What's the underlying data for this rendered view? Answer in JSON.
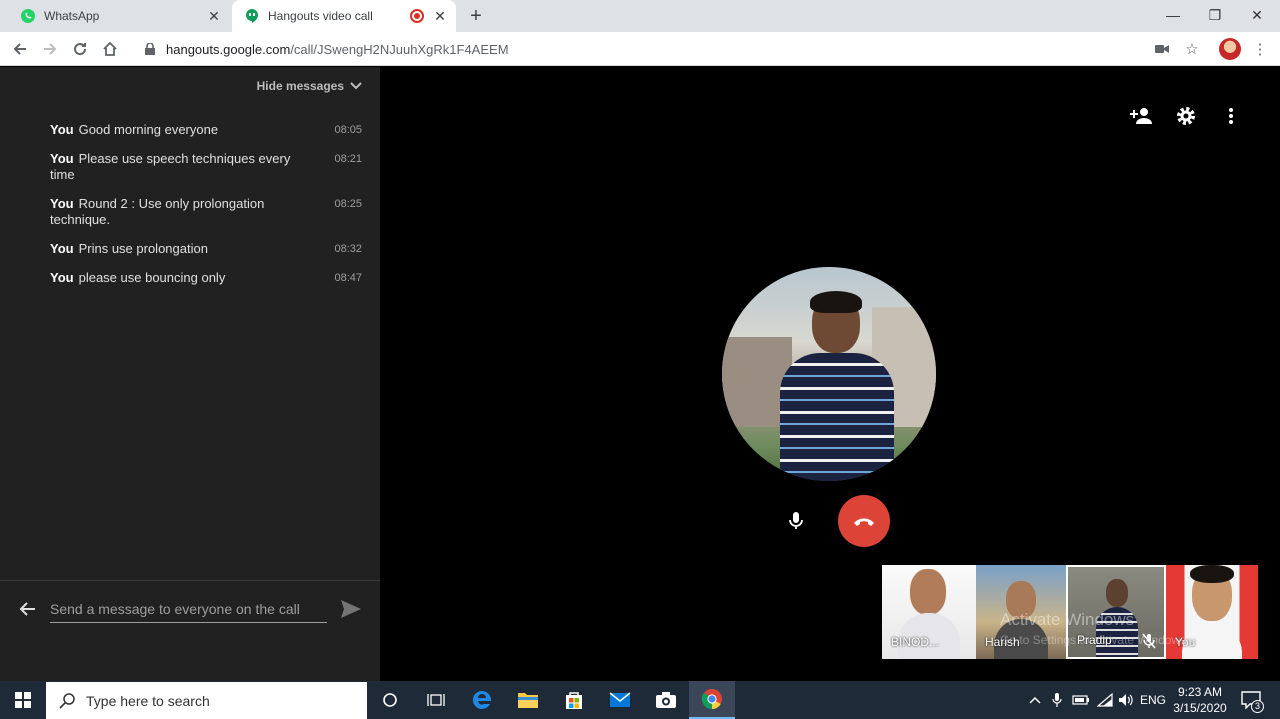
{
  "browser": {
    "tabs": [
      {
        "title": "WhatsApp",
        "active": false
      },
      {
        "title": "Hangouts video call",
        "active": true
      }
    ],
    "url_host": "hangouts.google.com",
    "url_path": "/call/JSwengH2NJuuhXgRk1F4AEEM"
  },
  "chat": {
    "hide_label": "Hide messages",
    "messages": [
      {
        "sender": "You",
        "text": "Good morning everyone",
        "time": "08:05"
      },
      {
        "sender": "You",
        "text": "Please use speech techniques every time",
        "time": "08:21"
      },
      {
        "sender": "You",
        "text": "Round 2 : Use only prolongation technique.",
        "time": "08:25"
      },
      {
        "sender": "You",
        "text": "Prins use prolongation",
        "time": "08:32"
      },
      {
        "sender": "You",
        "text": "please use bouncing only",
        "time": "08:47"
      }
    ],
    "input_placeholder": "Send a message to everyone on the call"
  },
  "call": {
    "participants": [
      {
        "name": "BINOD..."
      },
      {
        "name": "Harish"
      },
      {
        "name": "Pradip",
        "muted": true
      },
      {
        "name": "You"
      }
    ],
    "watermark": "Activate Windows",
    "watermark_sub": "Go to Settings to activate Windows."
  },
  "taskbar": {
    "search_placeholder": "Type here to search",
    "language": "ENG",
    "time": "9:23 AM",
    "date": "3/15/2020",
    "notification_count": "3"
  },
  "colors": {
    "chat_bg": "#212121",
    "hangup": "#db4437",
    "tab_strip": "#dee1e6",
    "taskbar": "#1f2a38"
  }
}
